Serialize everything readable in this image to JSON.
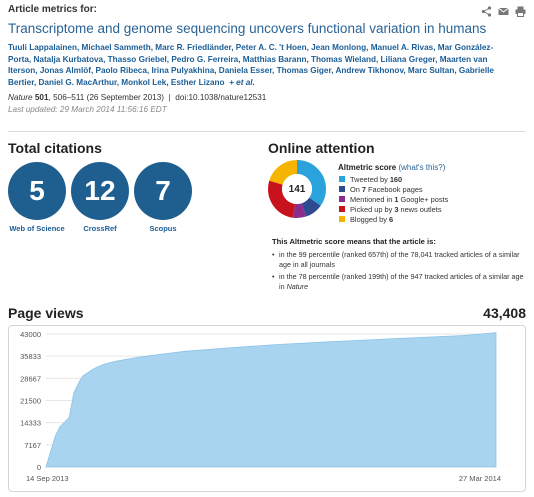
{
  "header": {
    "kicker": "Article metrics for:",
    "title": "Transcriptome and genome sequencing uncovers functional variation in humans",
    "authors": "Tuuli Lappalainen, Michael Sammeth, Marc R. Friedländer, Peter A. C. 't Hoen, Jean Monlong, Manuel A. Rivas, Mar González-Porta, Natalja Kurbatova, Thasso Griebel, Pedro G. Ferreira, Matthias Barann, Thomas Wieland, Liliana Greger, Maarten van Iterson, Jonas Almlöf, Paolo Ribeca, Irina Pulyakhina, Daniela Esser, Thomas Giger, Andrew Tikhonov, Marc Sultan, Gabrielle Bertier, Daniel G. MacArthur, Monkol Lek, Esther Lizano",
    "etal": "+ et al.",
    "journal": "Nature",
    "volume": "501",
    "pages_date": ", 506–511  (26 September 2013)",
    "sep": "|",
    "doi": "doi:10.1038/nature12531",
    "updated": "Last updated: 29 March 2014 11:56:16 EDT",
    "icons": [
      "share-icon",
      "email-icon",
      "print-icon"
    ]
  },
  "citations": {
    "heading": "Total citations",
    "items": [
      {
        "value": "5",
        "label": "Web of Science"
      },
      {
        "value": "12",
        "label": "CrossRef"
      },
      {
        "value": "7",
        "label": "Scopus"
      }
    ]
  },
  "attention": {
    "heading": "Online attention",
    "score": "141",
    "score_title": "Altmetric score",
    "whats_this": "(what's this?)",
    "rows": [
      {
        "pre": "Tweeted by",
        "num": "160",
        "post": "",
        "color": "#2aa3dd"
      },
      {
        "pre": "On",
        "num": "7",
        "post": "Facebook pages",
        "color": "#2d4b8e"
      },
      {
        "pre": "Mentioned in",
        "num": "1",
        "post": "Google+ posts",
        "color": "#8a2d8c"
      },
      {
        "pre": "Picked up by",
        "num": "3",
        "post": "news outlets",
        "color": "#c9131c"
      },
      {
        "pre": "Blogged by",
        "num": "6",
        "post": "",
        "color": "#f5b400"
      }
    ],
    "means_title": "This Altmetric score means that the article is:",
    "bullet1": "in the 99 percentile (ranked 657th) of the 78,041 tracked articles of a similar age in all journals",
    "bullet2_pre": "in the 78 percentile (ranked 199th) of the 947 tracked articles of a similar age in",
    "bullet2_journal": "Nature"
  },
  "pageviews": {
    "heading": "Page views",
    "total": "43,408"
  },
  "chart_data": {
    "type": "area",
    "title": "",
    "xlabel": "",
    "ylabel": "",
    "x_tick_labels": [
      "14 Sep 2013",
      "27 Mar 2014"
    ],
    "y_ticks": [
      "0",
      "7167",
      "14333",
      "21500",
      "28667",
      "35833",
      "43000"
    ],
    "ylim": [
      0,
      43000
    ],
    "x_days": [
      0,
      4,
      6,
      8,
      10,
      12,
      14,
      15,
      16,
      18,
      20,
      22,
      25,
      30,
      40,
      50,
      60,
      80,
      100,
      120,
      150,
      180,
      194
    ],
    "x": [
      "2013-09-14",
      "2013-09-18",
      "2013-09-20",
      "2013-09-22",
      "2013-09-24",
      "2013-09-26",
      "2013-09-28",
      "2013-09-29",
      "2013-09-30",
      "2013-10-02",
      "2013-10-04",
      "2013-10-06",
      "2013-10-09",
      "2013-10-14",
      "2013-10-24",
      "2013-11-03",
      "2013-11-13",
      "2013-12-03",
      "2013-12-23",
      "2014-01-12",
      "2014-02-11",
      "2014-03-13",
      "2014-03-27"
    ],
    "values": [
      0,
      10000,
      13000,
      14500,
      16000,
      24000,
      27000,
      28500,
      29500,
      30500,
      31500,
      32300,
      33200,
      34200,
      35500,
      36500,
      37400,
      38600,
      39600,
      40400,
      41500,
      42500,
      43408
    ],
    "fill": "#a9d4f0",
    "grid": true
  }
}
